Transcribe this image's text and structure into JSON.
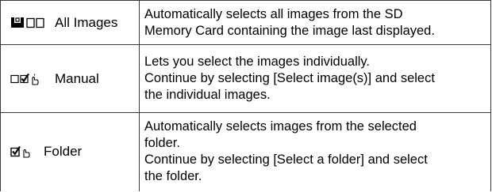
{
  "options": [
    {
      "label": "All Images",
      "icon": "all-images-icon",
      "description": [
        "Automatically selects all images from the SD",
        "Memory Card containing the image last displayed."
      ]
    },
    {
      "label": "Manual",
      "icon": "manual-select-icon",
      "description": [
        "Lets you select the images individually.",
        "Continue by selecting [Select image(s)] and select",
        "the individual images."
      ]
    },
    {
      "label": "Folder",
      "icon": "folder-select-icon",
      "description": [
        "Automatically selects images from the selected",
        "folder.",
        "Continue by selecting [Select a folder] and select",
        "the folder."
      ]
    }
  ]
}
